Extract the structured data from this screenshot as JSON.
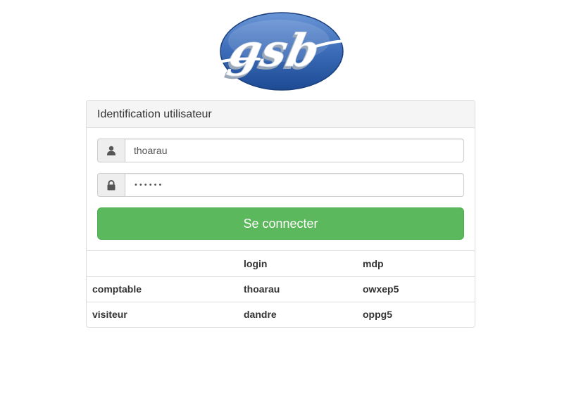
{
  "logo": {
    "text": "gsb"
  },
  "panel": {
    "heading": "Identification utilisateur"
  },
  "form": {
    "login_icon": "user-icon",
    "login_value": "thoarau",
    "password_icon": "lock-icon",
    "password_value": "••••••",
    "submit_label": "Se connecter"
  },
  "credentials_table": {
    "headers": [
      "",
      "login",
      "mdp"
    ],
    "rows": [
      [
        "comptable",
        "thoarau",
        "owxep5"
      ],
      [
        "visiteur",
        "dandre",
        "oppg5"
      ]
    ]
  },
  "colors": {
    "success": "#5cb85c",
    "logo_blue": "#2f5ea8"
  }
}
